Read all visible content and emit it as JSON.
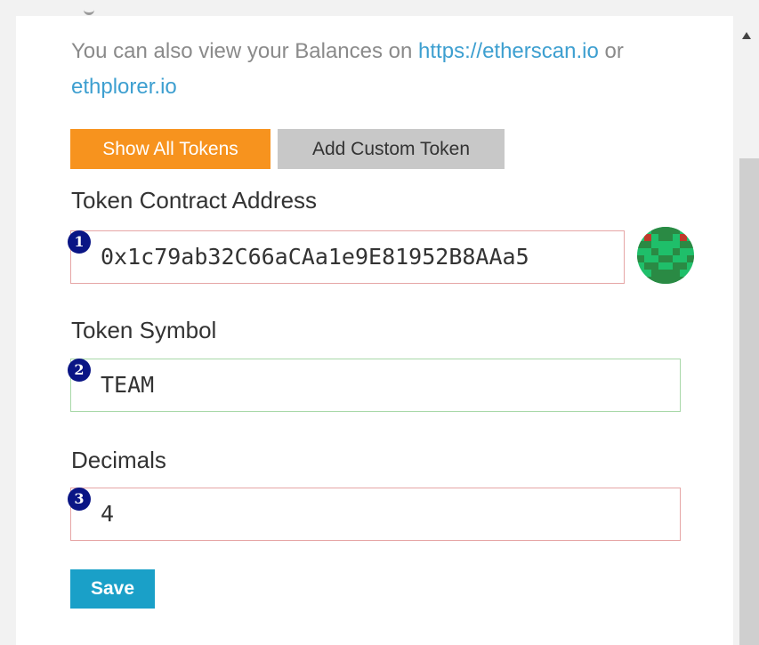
{
  "intro": {
    "text_before": "You can also view your Balances on ",
    "link1": "https://etherscan.io",
    "text_mid": " or ",
    "link2": "ethplorer.io"
  },
  "tabs": {
    "show_all": "Show All Tokens",
    "add_custom": "Add Custom Token"
  },
  "form": {
    "address_label": "Token Contract Address",
    "address_value": "0x1c79ab32C66aCAa1e9E81952B8AAa5",
    "symbol_label": "Token Symbol",
    "symbol_value": "TEAM",
    "decimals_label": "Decimals",
    "decimals_value": "4",
    "save_label": "Save"
  },
  "badges": [
    "1",
    "2",
    "3"
  ],
  "colors": {
    "orange": "#f7931e",
    "gray_button": "#c8c8c8",
    "save_blue": "#1aa0c8",
    "badge_navy": "#0a1585",
    "invalid_border": "#e6a6a6",
    "valid_border": "#a8d8a8"
  },
  "icons": {
    "avatar": "identicon-avatar",
    "scroll_up": "scroll-up-arrow-icon"
  }
}
